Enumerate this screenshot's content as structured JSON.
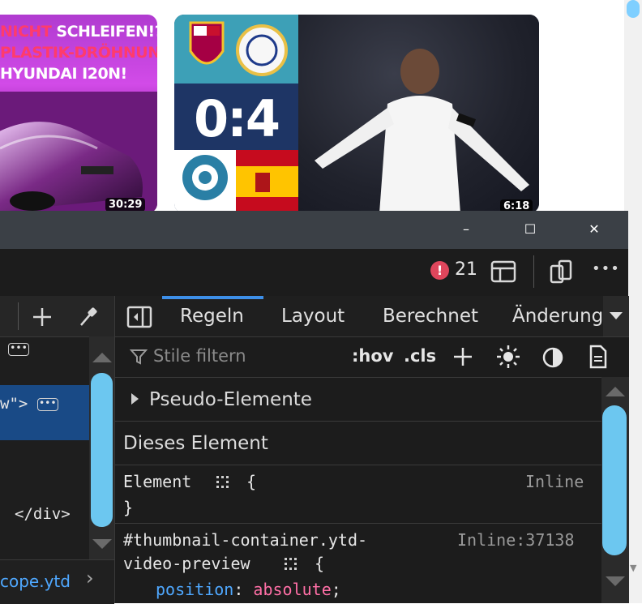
{
  "videos": [
    {
      "headline": [
        "NICHT SCHLEIFEN!?",
        "PLASTIK-DRÖHNUNG AM",
        "HYUNDAI I20N!"
      ],
      "duration": "30:29"
    },
    {
      "score": "0:4",
      "duration": "6:18"
    }
  ],
  "window": {
    "minimize": "–",
    "maximize": "☐",
    "close": "✕"
  },
  "toolbar": {
    "error_icon": "!",
    "error_count": "21",
    "more": "•••"
  },
  "elements_pane": {
    "lines": [
      "\">",
      "w\">",
      "</div>"
    ],
    "dots": "•••",
    "scope_link": "cope.ytd"
  },
  "styles_pane": {
    "tabs": [
      "Regeln",
      "Layout",
      "Berechnet",
      "Änderungen"
    ],
    "filter_placeholder": "Stile filtern",
    "hov": ":hov",
    "cls": ".cls",
    "pseudo_elements": "Pseudo-Elemente",
    "this_element": "Dieses Element",
    "element_rule": {
      "selector": "Element",
      "open": "{",
      "close": "}",
      "source": "Inline"
    },
    "rule2": {
      "selector_line1": "#thumbnail-container.ytd-",
      "selector_line2": "video-preview",
      "open": "{",
      "source": "Inline:37138",
      "property": "position",
      "value": "absolute"
    }
  }
}
